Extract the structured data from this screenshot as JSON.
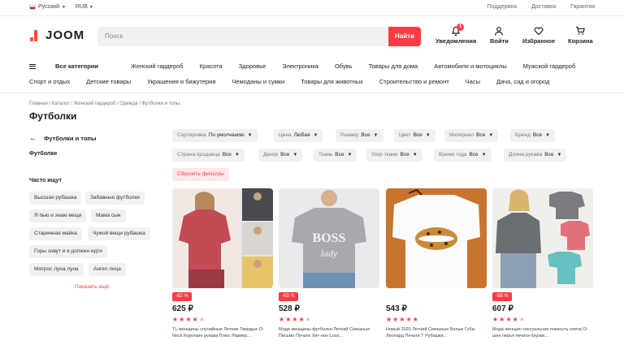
{
  "topbar": {
    "language": "Русский",
    "currency": "RUB",
    "links": [
      "Поддержка",
      "Доставка",
      "Гарантия"
    ]
  },
  "header": {
    "brand": "JOOM",
    "search_placeholder": "Поиск",
    "search_button": "Найти",
    "notifications_label": "Уведомления",
    "notifications_count": "1",
    "login_label": "Войти",
    "favorites_label": "Избранное",
    "cart_label": "Корзина"
  },
  "nav": {
    "row1": [
      "Все категории",
      "Женский гардероб",
      "Красота",
      "Здоровье",
      "Электроника",
      "Обувь",
      "Товары для дома",
      "Автомобили и мотоциклы",
      "Мужской гардероб"
    ],
    "row2": [
      "Спорт и отдых",
      "Детские товары",
      "Украшения и бижутерия",
      "Чемоданы и сумки",
      "Товары для животных",
      "Строительство и ремонт",
      "Часы",
      "Дача, сад и огород"
    ]
  },
  "breadcrumb": "Главная / Каталог / Женский гардероб / Одежда / Футболки и топы",
  "page_title": "Футболки",
  "sidebar": {
    "back_label": "Футболки и топы",
    "current": "Футболки",
    "popular_title": "Часто ищут",
    "tags": [
      "Высшая рубашка",
      "Забавные футболки",
      "Я пью и знаю вещи",
      "Мама сын",
      "Старинная майка",
      "Чужой вещи рубашка",
      "Горы зовут и я должен идти",
      "Матрос луна луна",
      "Ангел лица"
    ],
    "show_more": "Показать ещё"
  },
  "filters": [
    {
      "name": "Сортировка",
      "value": "По умолчанию"
    },
    {
      "name": "Цена",
      "value": "Любая"
    },
    {
      "name": "Размер",
      "value": "Все"
    },
    {
      "name": "Цвет",
      "value": "Все"
    },
    {
      "name": "Материал",
      "value": "Все"
    },
    {
      "name": "Бренд",
      "value": "Все"
    },
    {
      "name": "Страна продавца",
      "value": "Все"
    },
    {
      "name": "Декор",
      "value": "Все"
    },
    {
      "name": "Ткань",
      "value": "Все"
    },
    {
      "name": "Узор ткани",
      "value": "Все"
    },
    {
      "name": "Время года",
      "value": "Все"
    },
    {
      "name": "Длина рукава",
      "value": "Все"
    }
  ],
  "reset_filters": "Сбросить фильтры",
  "products": [
    {
      "discount": "-62 %",
      "price": "625 ₽",
      "rating": 4,
      "title": "TL-женщины случайные Летние Твердые O-Neck Короткие рукава Плюс Размер..."
    },
    {
      "discount": "-63 %",
      "price": "528 ₽",
      "rating": 4,
      "title": "Мода женщины футболки Летний Смешные Письмо Печати Хит-нон Loos..."
    },
    {
      "discount": "",
      "price": "543 ₽",
      "rating": 5,
      "title": "Новый 2020 Летний Смешные Белые Губы Леопард Печати Т Рубашки..."
    },
    {
      "discount": "-58 %",
      "price": "607 ₽",
      "rating": 4,
      "title": "Мода женщин сексуальная покинуть плеча O-шее перья печати блузки..."
    }
  ],
  "colors": {
    "accent": "#ff3a43",
    "chip_bg": "#f0f1f3"
  }
}
